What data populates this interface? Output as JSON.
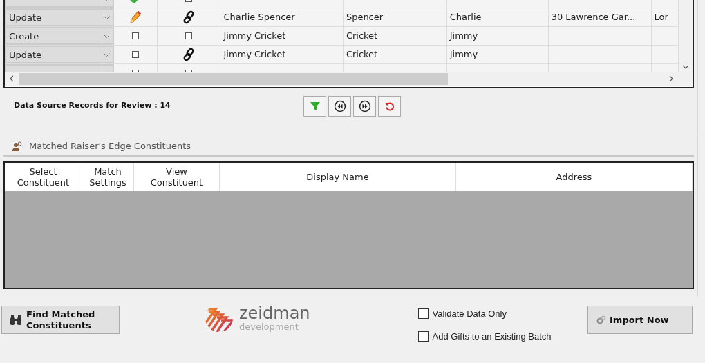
{
  "records_grid": {
    "rows": [
      {
        "new": true,
        "edited": false,
        "linked": false
      },
      {
        "action": "Update",
        "new": false,
        "edited": true,
        "linked": true,
        "display_name": "Charlie Spencer",
        "last_name": "Spencer",
        "first_name": "Charlie",
        "address": "30 Lawrence Gar...",
        "column_8": "Lor"
      },
      {
        "action": "Create",
        "new": false,
        "edited": false,
        "linked": false,
        "display_name": "Jimmy Cricket",
        "last_name": "Cricket",
        "first_name": "Jimmy"
      },
      {
        "action": "Update",
        "new": false,
        "edited": false,
        "linked": true,
        "display_name": "Jimmy Cricket",
        "last_name": "Cricket",
        "first_name": "Jimmy"
      },
      {
        "new": false,
        "edited": false,
        "linked": false
      }
    ]
  },
  "records_count": "Data Source Records for Review : 14",
  "matched_section": {
    "title": "Matched Raiser's Edge Constituents",
    "columns": [
      "Select Constituent",
      "Match Settings",
      "View Constituent",
      "Display Name",
      "Address"
    ]
  },
  "find_button": "Find Matched Constituents",
  "logo": {
    "name": "zeidman",
    "tagline": "development"
  },
  "options": [
    {
      "label": "Validate Data Only",
      "checked": false
    },
    {
      "label": "Add Gifts to an Existing Batch",
      "checked": false
    }
  ],
  "import_button": "Import Now"
}
